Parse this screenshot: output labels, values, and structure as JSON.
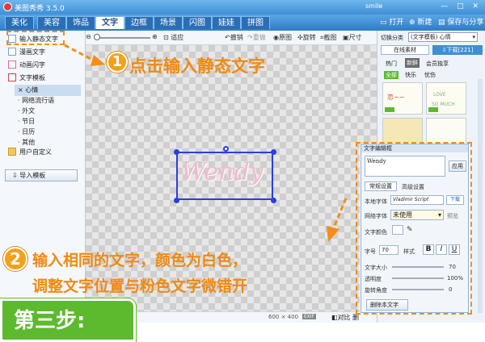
{
  "app": {
    "title": "美图秀秀 3.5.0",
    "user": "smile",
    "window_controls": "— □ ✕"
  },
  "tabs": [
    "美化",
    "美容",
    "饰品",
    "文字",
    "边框",
    "场景",
    "闪图",
    "娃娃",
    "拼图"
  ],
  "active_tab": "文字",
  "top_buttons": {
    "open": "打开",
    "new": "新建",
    "save": "保存与分享"
  },
  "left_panel": {
    "items": [
      "输入静态文字",
      "漫画文字",
      "动画闪字",
      "文字模板"
    ],
    "template_subitems": [
      "心情",
      "网络流行语",
      "外文",
      "节日",
      "日历",
      "其他"
    ],
    "user_custom": "用户自定义",
    "import_template": "导入模板"
  },
  "toolbar": {
    "fit": "适应",
    "undo": "撤销",
    "redo": "重做",
    "original": "原图",
    "rotate": "旋转",
    "crop": "截图",
    "size": "尺寸"
  },
  "canvas": {
    "text": "Wendy"
  },
  "statusbar": {
    "size": "600 × 400",
    "exif": "EXIF",
    "compare": "对比",
    "delete": "删"
  },
  "right_panel": {
    "switch_label": "切换分类",
    "category": "(文字模板) 心情",
    "online_tab": "在线素材",
    "download": "下载[221]",
    "filter_tabs": [
      "热门",
      "新鲜",
      "会员独享"
    ],
    "sub_filters": [
      "全部",
      "快乐",
      "忧伤"
    ]
  },
  "dialog": {
    "title": "文字编辑框",
    "input_text": "Wendy",
    "apply": "应用",
    "tabs": [
      "常规设置",
      "高级设置"
    ],
    "local_font_label": "本地字体",
    "local_font": "Vladimir Script",
    "download_btn": "下载",
    "network_font_label": "网络字体",
    "network_font": "未使用",
    "preview_btn": "预览",
    "color_label": "文字颜色",
    "size_label": "字号",
    "size_value": "70",
    "style_label": "样式",
    "text_size_label": "文字大小",
    "text_size_value": "70",
    "opacity_label": "透明度",
    "opacity_value": "100%",
    "angle_label": "旋转角度",
    "angle_value": "0",
    "delete_btn": "删除本文字"
  },
  "annotations": {
    "step1_num": "1",
    "step1_text": "点击输入静态文字",
    "step2_num": "2",
    "step2_line1": "输入相同的文字，颜色为白色，",
    "step2_line2": "调整文字位置与粉色文字微错开",
    "step3": "第三步:"
  },
  "colors": {
    "accent": "#f08a12",
    "titlebar": "#3f8fd6",
    "step3_bg": "#5dba2e",
    "text_pink": "#f5b9cc",
    "selection": "#2b3ee0"
  }
}
